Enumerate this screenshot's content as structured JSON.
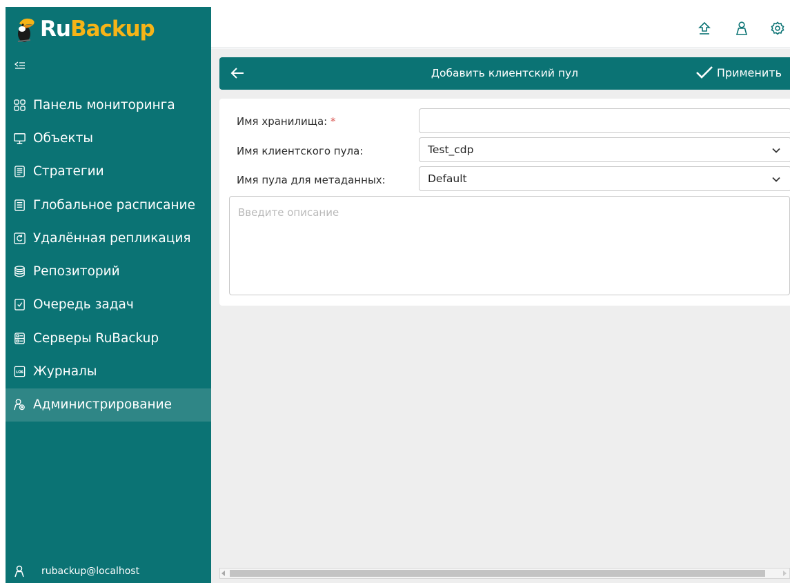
{
  "brand": {
    "ru": "Ru",
    "backup": "Backup"
  },
  "sidebar": {
    "items": [
      {
        "label": "Панель мониторинга",
        "icon": "dashboard-icon"
      },
      {
        "label": "Объекты",
        "icon": "monitor-icon"
      },
      {
        "label": "Стратегии",
        "icon": "strategy-icon"
      },
      {
        "label": "Глобальное расписание",
        "icon": "schedule-icon"
      },
      {
        "label": "Удалённая репликация",
        "icon": "replication-icon"
      },
      {
        "label": "Репозиторий",
        "icon": "database-icon"
      },
      {
        "label": "Очередь задач",
        "icon": "task-queue-icon"
      },
      {
        "label": "Серверы RuBackup",
        "icon": "server-icon"
      },
      {
        "label": "Журналы",
        "icon": "log-icon"
      },
      {
        "label": "Администрирование",
        "icon": "admin-icon",
        "active": true
      }
    ],
    "user": "rubackup@localhost"
  },
  "toolbar": {
    "title": "Добавить клиентский пул",
    "apply_label": "Применить"
  },
  "form": {
    "storage_name_label": "Имя хранилища:",
    "required_mark": "*",
    "storage_name_value": "",
    "client_pool_label": "Имя клиентского пула:",
    "client_pool_value": "Test_cdp",
    "metadata_pool_label": "Имя пула для метаданных:",
    "metadata_pool_value": "Default",
    "description_placeholder": "Введите описание"
  },
  "colors": {
    "teal": "#0b7374",
    "active": "#2f8686",
    "brand_yellow": "#f6b417"
  }
}
